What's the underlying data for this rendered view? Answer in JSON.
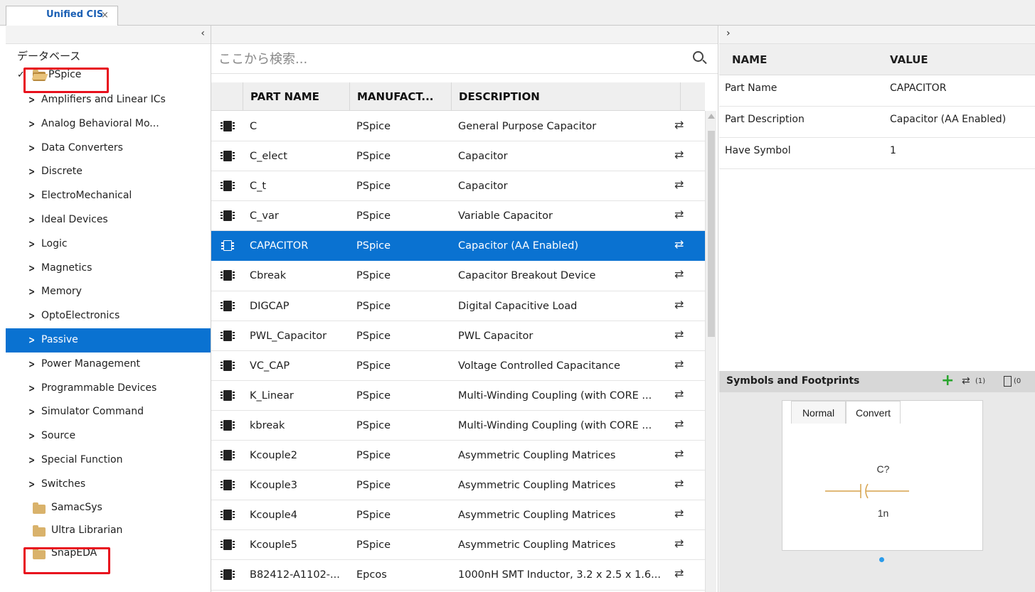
{
  "tab": {
    "title": "Unified CIS",
    "close": "×"
  },
  "left": {
    "collapse": "‹",
    "database_label": "データベース",
    "root": {
      "label": "PSpice"
    },
    "categories": [
      "Amplifiers and Linear ICs",
      "Analog Behavioral Mo...",
      "Data Converters",
      "Discrete",
      "ElectroMechanical",
      "Ideal Devices",
      "Logic",
      "Magnetics",
      "Memory",
      "OptoElectronics",
      "Passive",
      "Power Management",
      "Programmable Devices",
      "Simulator Command",
      "Source",
      "Special Function",
      "Switches"
    ],
    "selected_category": "Passive",
    "other_libraries": [
      "SamacSys",
      "Ultra Librarian",
      "SnapEDA"
    ]
  },
  "search": {
    "placeholder": "ここから検索..."
  },
  "table": {
    "headers": {
      "part_name": "PART NAME",
      "manufacturer": "MANUFACT...",
      "description": "DESCRIPTION"
    },
    "rows": [
      {
        "part": "C",
        "mfr": "PSpice",
        "desc": "General Purpose Capacitor"
      },
      {
        "part": "C_elect",
        "mfr": "PSpice",
        "desc": "Capacitor"
      },
      {
        "part": "C_t",
        "mfr": "PSpice",
        "desc": "Capacitor"
      },
      {
        "part": "C_var",
        "mfr": "PSpice",
        "desc": "Variable Capacitor"
      },
      {
        "part": "CAPACITOR",
        "mfr": "PSpice",
        "desc": "Capacitor (AA Enabled)"
      },
      {
        "part": "Cbreak",
        "mfr": "PSpice",
        "desc": "Capacitor Breakout Device"
      },
      {
        "part": "DIGCAP",
        "mfr": "PSpice",
        "desc": "Digital Capacitive Load"
      },
      {
        "part": "PWL_Capacitor",
        "mfr": "PSpice",
        "desc": "PWL Capacitor"
      },
      {
        "part": "VC_CAP",
        "mfr": "PSpice",
        "desc": "Voltage Controlled Capacitance"
      },
      {
        "part": "K_Linear",
        "mfr": "PSpice",
        "desc": "Multi-Winding Coupling (with CORE ..."
      },
      {
        "part": "kbreak",
        "mfr": "PSpice",
        "desc": "Multi-Winding Coupling (with CORE ..."
      },
      {
        "part": "Kcouple2",
        "mfr": "PSpice",
        "desc": "Asymmetric Coupling Matrices"
      },
      {
        "part": "Kcouple3",
        "mfr": "PSpice",
        "desc": "Asymmetric Coupling Matrices"
      },
      {
        "part": "Kcouple4",
        "mfr": "PSpice",
        "desc": "Asymmetric Coupling Matrices"
      },
      {
        "part": "Kcouple5",
        "mfr": "PSpice",
        "desc": "Asymmetric Coupling Matrices"
      },
      {
        "part": "B82412-A1102-...",
        "mfr": "Epcos",
        "desc": "1000nH SMT Inductor, 3.2 x 2.5 x 1.6..."
      }
    ],
    "selected_part": "CAPACITOR"
  },
  "props": {
    "expand": "›",
    "headers": {
      "name": "NAME",
      "value": "VALUE"
    },
    "rows": [
      {
        "name": "Part Name",
        "value": "CAPACITOR"
      },
      {
        "name": "Part Description",
        "value": "Capacitor (AA Enabled)"
      },
      {
        "name": "Have Symbol",
        "value": "1"
      }
    ]
  },
  "symbols": {
    "title": "Symbols and Footprints",
    "add": "+",
    "symbol_count": "(1)",
    "footprint_count": "(0",
    "tabs": {
      "normal": "Normal",
      "convert": "Convert"
    },
    "preview": {
      "refdes": "C?",
      "value": "1n"
    }
  },
  "colors": {
    "selection": "#0a72d1",
    "highlight_box": "#e8101d",
    "add_green": "#2aa52e"
  }
}
